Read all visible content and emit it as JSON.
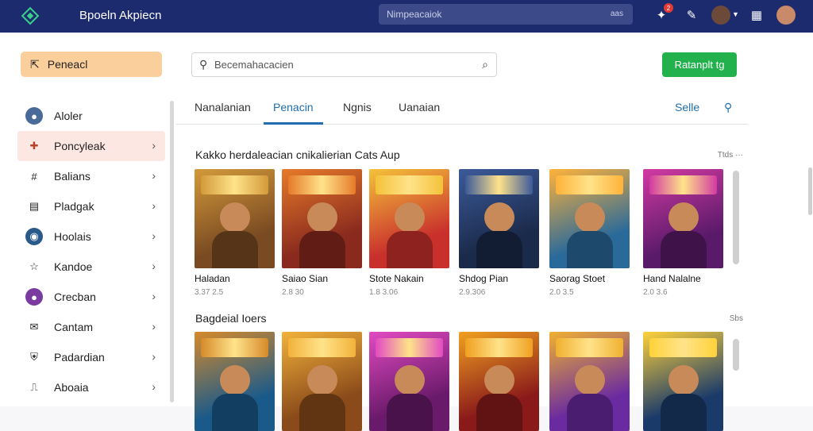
{
  "app": {
    "title": "Bpoeln Akpiecn"
  },
  "top_search": {
    "placeholder": "Nimpeacaiok",
    "shortcut": "aas"
  },
  "top_icons": [
    "gamepad-icon",
    "pencil-icon",
    "avatar",
    "grid-icon",
    "profile-avatar"
  ],
  "notification_count": "2",
  "sidebar": {
    "pinned_label": "Peneacl",
    "items": [
      {
        "label": "Aloler",
        "icon": "user-avatar"
      },
      {
        "label": "Poncyleak",
        "icon": "puzzle-icon"
      },
      {
        "label": "Balians",
        "icon": "hash-icon"
      },
      {
        "label": "Pladgak",
        "icon": "card-icon"
      },
      {
        "label": "Hoolais",
        "icon": "globe-icon"
      },
      {
        "label": "Kandoe",
        "icon": "star-icon"
      },
      {
        "label": "Crecban",
        "icon": "person-icon"
      },
      {
        "label": "Cantam",
        "icon": "mail-icon"
      },
      {
        "label": "Padardian",
        "icon": "shield-icon"
      },
      {
        "label": "Aboaia",
        "icon": "bookmark-icon"
      }
    ]
  },
  "main": {
    "search_placeholder": "Becemahacacien",
    "cta_label": "Ratanplt tg",
    "tabs": [
      "Nanalanian",
      "Penacin",
      "Ngnis",
      "Uanaian"
    ],
    "active_tab": 1,
    "tab_side_label": "Selle",
    "sections": [
      {
        "title": "Kakko herdaleacian cnikalierian Cats Aup",
        "more": "Ttds ···",
        "cards": [
          {
            "name": "Haladan",
            "meta": "3.37 2.5",
            "colors": [
              "#7a4a22",
              "#d39a3a"
            ]
          },
          {
            "name": "Saiao Sian",
            "meta": "2.8 30",
            "colors": [
              "#8a2a1e",
              "#e67a2a"
            ]
          },
          {
            "name": "Stote Nakain",
            "meta": "1.8 3.06",
            "colors": [
              "#c9302c",
              "#f4c23a"
            ]
          },
          {
            "name": "Shdog Pian",
            "meta": "2.9.306",
            "colors": [
              "#1a2a4a",
              "#3c5a9a"
            ]
          },
          {
            "name": "Saorag Stoet",
            "meta": "2.0 3.5",
            "colors": [
              "#2a6a9a",
              "#ffb23a"
            ]
          },
          {
            "name": "Hand Nalalne",
            "meta": "2.0 3.6",
            "colors": [
              "#5a1a6a",
              "#d23aa2"
            ]
          }
        ]
      },
      {
        "title": "Bagdeial Ioers",
        "more": "Sbs",
        "cards": [
          {
            "name": "",
            "meta": "",
            "colors": [
              "#1a5a8a",
              "#d68a2a"
            ]
          },
          {
            "name": "",
            "meta": "",
            "colors": [
              "#8a4a1a",
              "#f2b23a"
            ]
          },
          {
            "name": "",
            "meta": "",
            "colors": [
              "#6a1a6a",
              "#e24ac2"
            ]
          },
          {
            "name": "",
            "meta": "",
            "colors": [
              "#8a1a1a",
              "#f0a020"
            ]
          },
          {
            "name": "",
            "meta": "",
            "colors": [
              "#6a2aa0",
              "#f0b030"
            ]
          },
          {
            "name": "",
            "meta": "",
            "colors": [
              "#1a3a6a",
              "#ffd23a"
            ]
          }
        ]
      }
    ]
  },
  "colors": {
    "topbar": "#1c2a6e",
    "accent": "#1f6fb0",
    "cta": "#22b14c",
    "pinned": "#fbcf9c",
    "active_item": "#fde7e2"
  }
}
